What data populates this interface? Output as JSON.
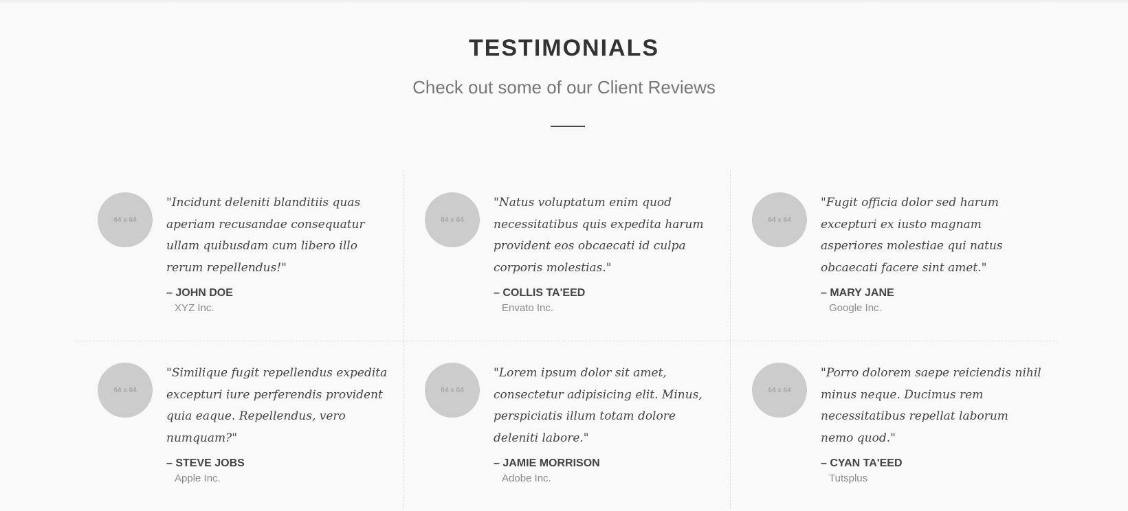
{
  "section": {
    "title": "TESTIMONIALS",
    "subtitle": "Check out some of our Client Reviews"
  },
  "avatar_placeholder": "64 x 64",
  "testimonials": [
    {
      "quote": "\"Incidunt deleniti blanditiis quas aperiam recusandae consequatur ullam quibusdam cum libero illo rerum repellendus!\"",
      "author": "– JOHN DOE",
      "company": "XYZ Inc."
    },
    {
      "quote": "\"Natus voluptatum enim quod necessitatibus quis expedita harum provident eos obcaecati id culpa corporis molestias.\"",
      "author": "– COLLIS TA'EED",
      "company": "Envato Inc."
    },
    {
      "quote": "\"Fugit officia dolor sed harum excepturi ex iusto magnam asperiores molestiae qui natus obcaecati facere sint amet.\"",
      "author": "– MARY JANE",
      "company": "Google Inc."
    },
    {
      "quote": "\"Similique fugit repellendus expedita excepturi iure perferendis provident quia eaque. Repellendus, vero numquam?\"",
      "author": "– STEVE JOBS",
      "company": "Apple Inc."
    },
    {
      "quote": "\"Lorem ipsum dolor sit amet, consectetur adipisicing elit. Minus, perspiciatis illum totam dolore deleniti labore.\"",
      "author": "– JAMIE MORRISON",
      "company": "Adobe Inc."
    },
    {
      "quote": "\"Porro dolorem saepe reiciendis nihil minus neque. Ducimus rem necessitatibus repellat laborum nemo quod.\"",
      "author": "– CYAN TA'EED",
      "company": "Tutsplus"
    }
  ]
}
